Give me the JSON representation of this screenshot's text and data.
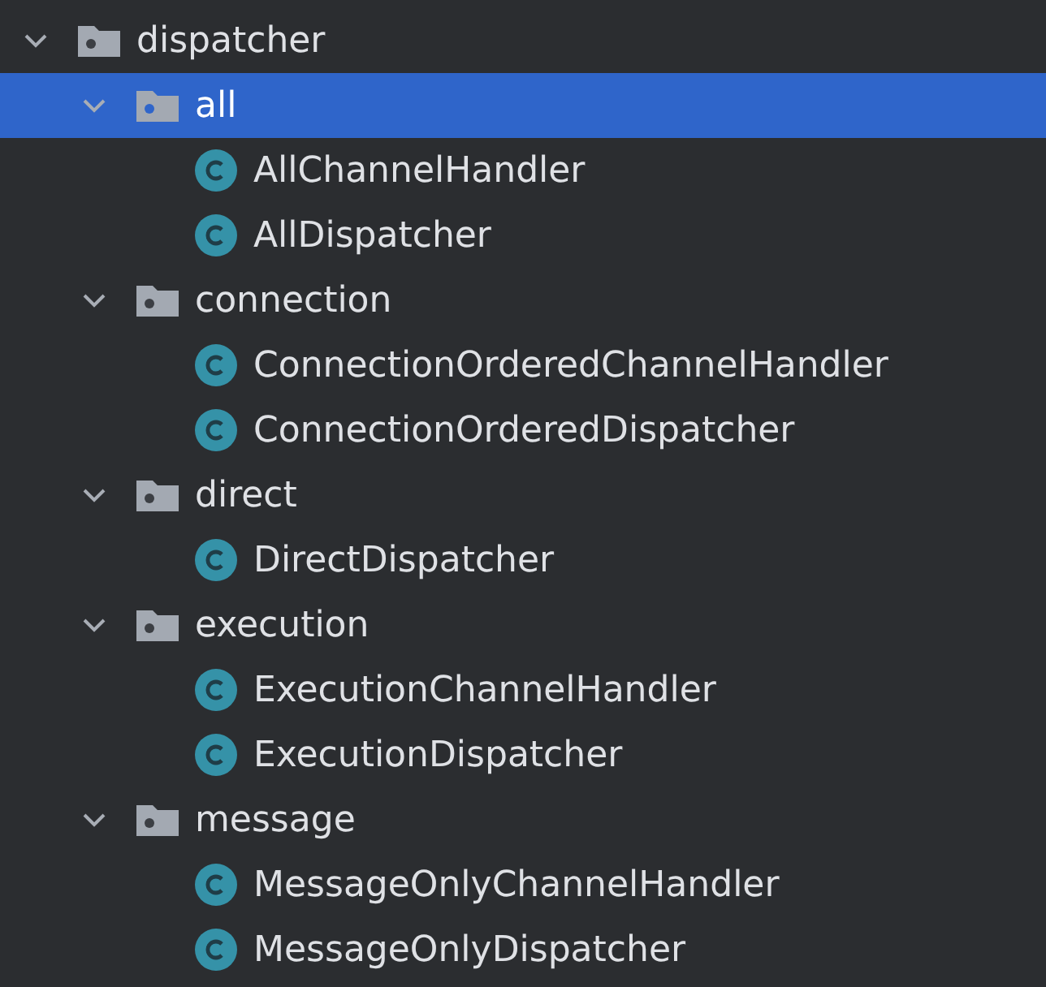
{
  "tree": [
    {
      "kind": "package",
      "name": "dispatcher",
      "expanded": true,
      "selected": false,
      "children": [
        {
          "kind": "package",
          "name": "all",
          "expanded": true,
          "selected": true,
          "children": [
            {
              "kind": "class",
              "name": "AllChannelHandler",
              "selected": false
            },
            {
              "kind": "class",
              "name": "AllDispatcher",
              "selected": false
            }
          ]
        },
        {
          "kind": "package",
          "name": "connection",
          "expanded": true,
          "selected": false,
          "children": [
            {
              "kind": "class",
              "name": "ConnectionOrderedChannelHandler",
              "selected": false
            },
            {
              "kind": "class",
              "name": "ConnectionOrderedDispatcher",
              "selected": false
            }
          ]
        },
        {
          "kind": "package",
          "name": "direct",
          "expanded": true,
          "selected": false,
          "children": [
            {
              "kind": "class",
              "name": "DirectDispatcher",
              "selected": false
            }
          ]
        },
        {
          "kind": "package",
          "name": "execution",
          "expanded": true,
          "selected": false,
          "children": [
            {
              "kind": "class",
              "name": "ExecutionChannelHandler",
              "selected": false
            },
            {
              "kind": "class",
              "name": "ExecutionDispatcher",
              "selected": false
            }
          ]
        },
        {
          "kind": "package",
          "name": "message",
          "expanded": true,
          "selected": false,
          "children": [
            {
              "kind": "class",
              "name": "MessageOnlyChannelHandler",
              "selected": false
            },
            {
              "kind": "class",
              "name": "MessageOnlyDispatcher",
              "selected": false
            }
          ]
        }
      ]
    }
  ]
}
